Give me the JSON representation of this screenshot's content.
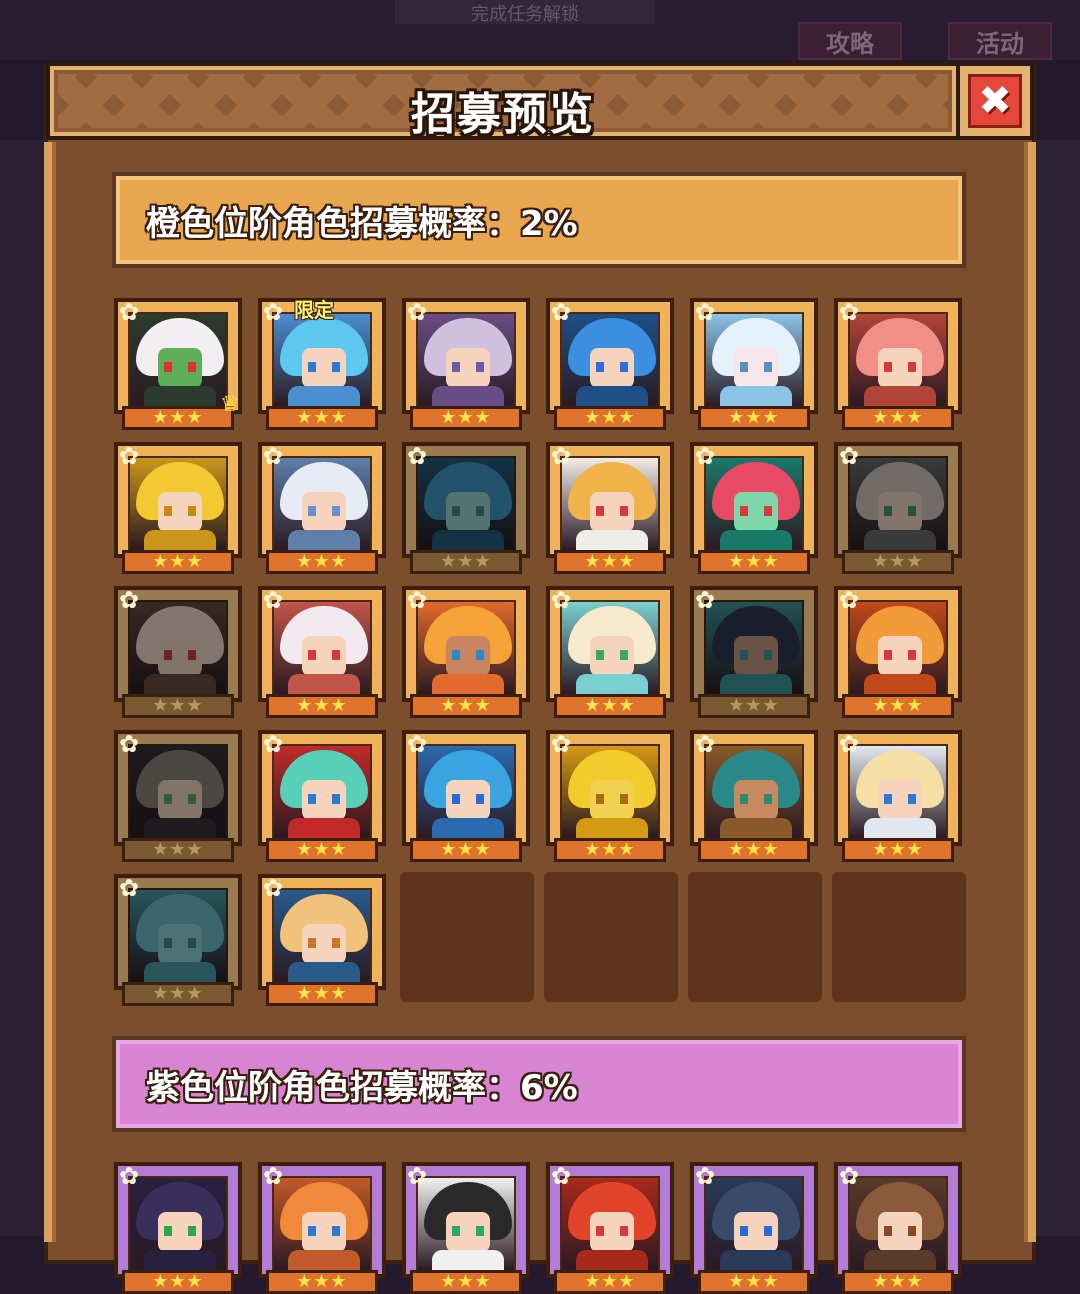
{
  "background": {
    "banner_text": "完成任务解锁",
    "buttons": [
      "攻略",
      "活动"
    ]
  },
  "window": {
    "title": "招募预览",
    "close_label": "✖"
  },
  "orange_section": {
    "label": "橙色位阶角色招募概率：2%",
    "color": "#e8a74e",
    "cards": [
      {
        "hair": "#f2eef2",
        "cloth": "#2d3b2e",
        "skin": "#5fae5a",
        "eye": "#e0302a",
        "stars": 3,
        "crown": true,
        "dim": false
      },
      {
        "hair": "#5cc7ef",
        "cloth": "#4b8fd1",
        "skin": "#f6d3bd",
        "eye": "#2f7ad6",
        "stars": 3,
        "limited": "限定",
        "dim": false
      },
      {
        "hair": "#cfc0dd",
        "cloth": "#6a4d86",
        "skin": "#f6d3bd",
        "eye": "#6d5aa6",
        "stars": 3,
        "dim": false
      },
      {
        "hair": "#3c8fe0",
        "cloth": "#1f4f86",
        "skin": "#f6d3bd",
        "eye": "#2f6bd6",
        "stars": 3,
        "dim": false
      },
      {
        "hair": "#e6f2fb",
        "cloth": "#8cc4e6",
        "skin": "#f7e6ea",
        "eye": "#5b8fc4",
        "stars": 3,
        "dim": false
      },
      {
        "hair": "#f08f86",
        "cloth": "#b2443a",
        "skin": "#f6d3bd",
        "eye": "#d63a3a",
        "stars": 3,
        "dim": false
      },
      {
        "hair": "#f2c930",
        "cloth": "#c9961b",
        "skin": "#f6d3bd",
        "eye": "#c58a12",
        "stars": 3,
        "dim": false
      },
      {
        "hair": "#e6eaf2",
        "cloth": "#5f7fa8",
        "skin": "#f6d3bd",
        "eye": "#6a8fd0",
        "stars": 3,
        "dim": false
      },
      {
        "hair": "#2e9ad0",
        "cloth": "#155f87",
        "skin": "#8fd6d0",
        "eye": "#2e8c7a",
        "stars": 3,
        "dim": true
      },
      {
        "hair": "#f2b24a",
        "cloth": "#f0ece8",
        "skin": "#f6d3bd",
        "eye": "#d63a3a",
        "stars": 3,
        "dim": false
      },
      {
        "hair": "#e84a66",
        "cloth": "#1a7a6a",
        "skin": "#7fd6a8",
        "eye": "#d63a3a",
        "stars": 3,
        "dim": false
      },
      {
        "hair": "#cfc4b8",
        "cloth": "#6a6a6a",
        "skin": "#f6d3bd",
        "eye": "#3a9a6a",
        "stars": 3,
        "dim": true
      },
      {
        "hair": "#f0d6c4",
        "cloth": "#6a4a3a",
        "skin": "#f6d3bd",
        "eye": "#d63a3a",
        "stars": 3,
        "dim": true
      },
      {
        "hair": "#f2eaf0",
        "cloth": "#c2554a",
        "skin": "#f6d3bd",
        "eye": "#d63a3a",
        "stars": 3,
        "dim": false
      },
      {
        "hair": "#f5a236",
        "cloth": "#e26a2c",
        "skin": "#c98560",
        "eye": "#2a8ac4",
        "stars": 3,
        "dim": false
      },
      {
        "hair": "#f6e9cc",
        "cloth": "#7ad0d0",
        "skin": "#f6d3bd",
        "eye": "#3aa85a",
        "stars": 3,
        "dim": false
      },
      {
        "hair": "#2b3556",
        "cloth": "#2a9aa0",
        "skin": "#c7967a",
        "eye": "#2a9aa0",
        "stars": 3,
        "dim": true
      },
      {
        "hair": "#f09a3a",
        "cloth": "#c24a1a",
        "skin": "#f6d3bd",
        "eye": "#d63a3a",
        "stars": 3,
        "dim": false
      },
      {
        "hair": "#8a8078",
        "cloth": "#3a2f3a",
        "skin": "#f6d3bd",
        "eye": "#5aa85a",
        "stars": 3,
        "dim": true
      },
      {
        "hair": "#58d0b8",
        "cloth": "#c22a2a",
        "skin": "#f6d3bd",
        "eye": "#2a7ad6",
        "stars": 3,
        "dim": false
      },
      {
        "hair": "#3aa4e0",
        "cloth": "#2a6ab0",
        "skin": "#f6d3bd",
        "eye": "#2a6ad6",
        "stars": 3,
        "dim": false
      },
      {
        "hair": "#f2cc2a",
        "cloth": "#d49a14",
        "skin": "#f2d050",
        "eye": "#a86a10",
        "stars": 3,
        "dim": false
      },
      {
        "hair": "#2a8a8a",
        "cloth": "#8a5a2a",
        "skin": "#c78a60",
        "eye": "#2a8a6a",
        "stars": 3,
        "dim": false
      },
      {
        "hair": "#f6dfa4",
        "cloth": "#e2e8f0",
        "skin": "#f6d3bd",
        "eye": "#2a7ad6",
        "stars": 3,
        "dim": false
      },
      {
        "hair": "#5ac0d0",
        "cloth": "#3aa0b0",
        "skin": "#7fd0d8",
        "eye": "#2a8aa0",
        "stars": 3,
        "dim": true
      },
      {
        "hair": "#f2c27a",
        "cloth": "#2a5a8a",
        "skin": "#f6d3bd",
        "eye": "#c8742a",
        "stars": 3,
        "dim": false
      }
    ]
  },
  "purple_section": {
    "label": "紫色位阶角色招募概率：6%",
    "color": "#d784d2",
    "cards": [
      {
        "hair": "#3a2f5a",
        "cloth": "#2a2040",
        "skin": "#f6d3bd",
        "eye": "#2aa84a",
        "stars": 3
      },
      {
        "hair": "#f08a3a",
        "cloth": "#c25a2a",
        "skin": "#f6d3bd",
        "eye": "#2a7ad6",
        "stars": 3
      },
      {
        "hair": "#2a2a2a",
        "cloth": "#f0f0f0",
        "skin": "#f6d3bd",
        "eye": "#2aa86a",
        "stars": 3
      },
      {
        "hair": "#e2442a",
        "cloth": "#a82a1a",
        "skin": "#f6d3bd",
        "eye": "#d63a3a",
        "stars": 3
      },
      {
        "hair": "#3a4a6a",
        "cloth": "#2a3a5a",
        "skin": "#f6d3bd",
        "eye": "#2a6ad6",
        "stars": 3
      },
      {
        "hair": "#8a5a3a",
        "cloth": "#5a3a2a",
        "skin": "#f6d3bd",
        "eye": "#8a4a2a",
        "stars": 3
      }
    ]
  }
}
